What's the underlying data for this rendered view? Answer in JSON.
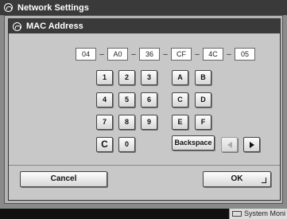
{
  "window": {
    "title": "Network Settings"
  },
  "dialog": {
    "title": "MAC Address",
    "mac_fields": [
      "04",
      "A0",
      "36",
      "CF",
      "4C",
      "05"
    ],
    "separator": "–"
  },
  "keypad": {
    "digits": [
      "1",
      "2",
      "3",
      "4",
      "5",
      "6",
      "7",
      "8",
      "9",
      "0"
    ],
    "letters": [
      "A",
      "B",
      "C",
      "D",
      "E",
      "F"
    ],
    "clear": "C",
    "backspace": "Backspace"
  },
  "footer": {
    "cancel": "Cancel",
    "ok": "OK"
  },
  "taskbar": {
    "system_monitor": "System Moni"
  },
  "colors": {
    "titlebar": "#3a3a3a",
    "panel": "#c8c8c8",
    "frame": "#b5b5b5"
  }
}
